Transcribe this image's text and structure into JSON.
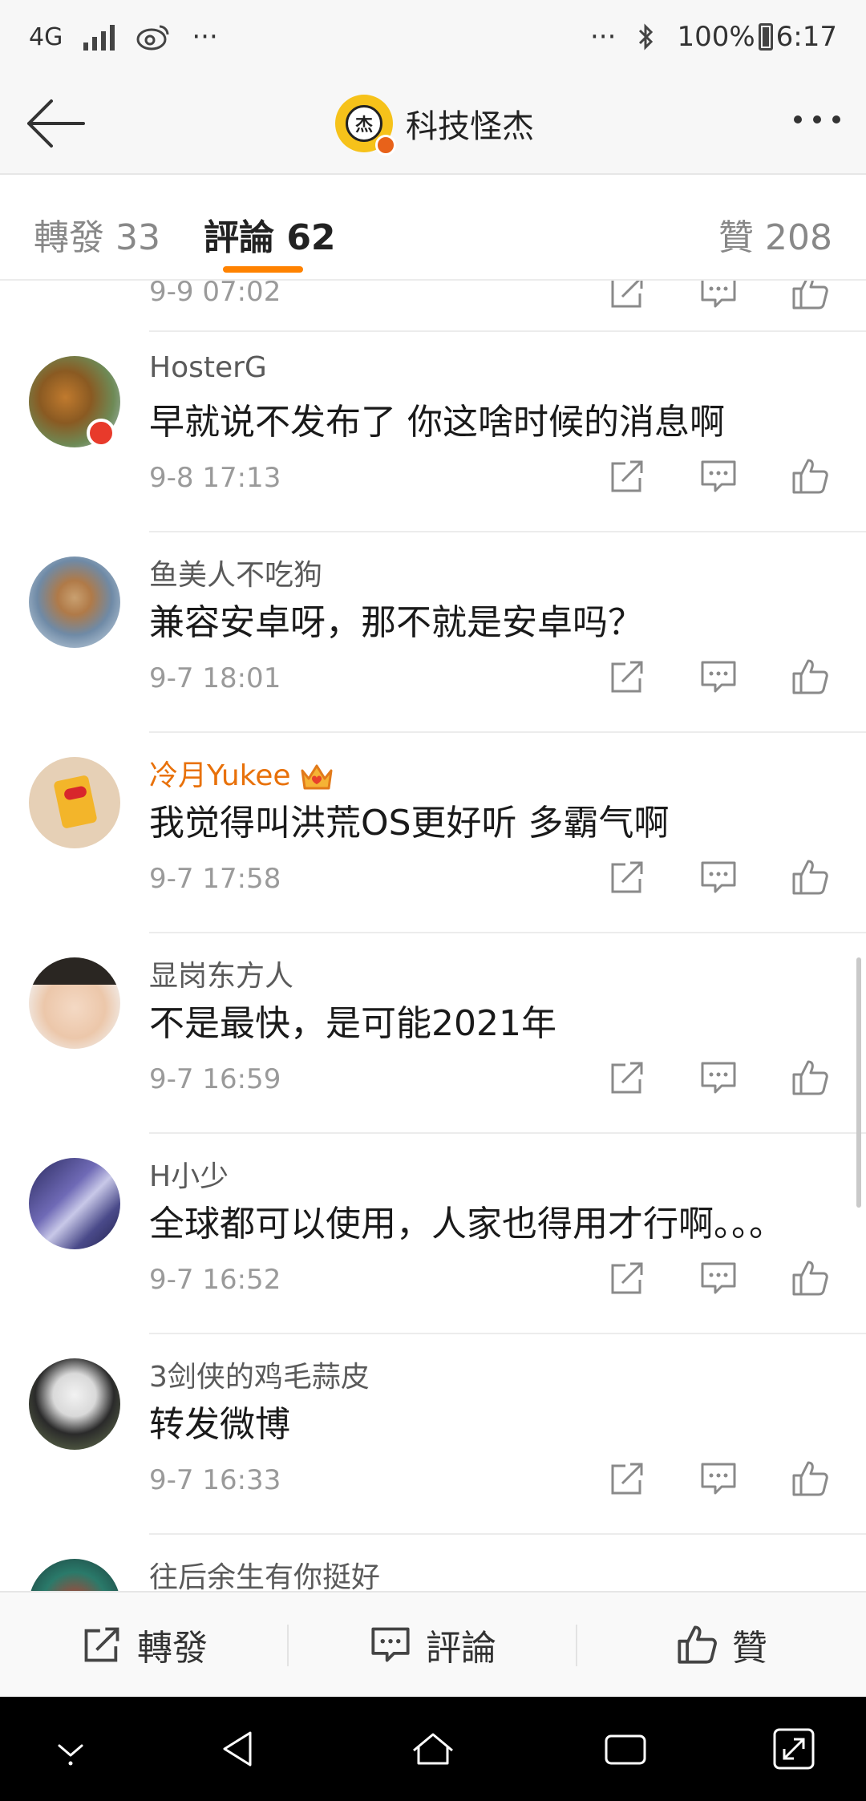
{
  "status_bar": {
    "network": "4G",
    "dots_left": "···",
    "dots_right": "···",
    "battery": "100%",
    "time": "6:17"
  },
  "header": {
    "avatar_glyph": "杰",
    "title": "科技怪杰"
  },
  "tabs": [
    {
      "label": "轉發 33"
    },
    {
      "label": "評論 62"
    },
    {
      "label": "贊 208"
    }
  ],
  "partial_row": {
    "time": "9-9 07:02"
  },
  "comments": [
    {
      "username": "HosterG",
      "text": "早就说不发布了 你这啥时候的消息啊",
      "time": "9-8 17:13"
    },
    {
      "username": "鱼美人不吃狗",
      "text": "兼容安卓呀，那不就是安卓吗？",
      "time": "9-7 18:01"
    },
    {
      "username": "冷月Yukee",
      "text": "我觉得叫洪荒OS更好听 多霸气啊",
      "time": "9-7 17:58"
    },
    {
      "username": "显岗东方人",
      "text": "不是最快，是可能2021年",
      "time": "9-7 16:59"
    },
    {
      "username": "H小少",
      "text": "全球都可以使用，人家也得用才行啊。。。",
      "time": "9-7 16:52"
    },
    {
      "username": "3剑侠的鸡毛蒜皮",
      "text": "转发微博",
      "time": "9-7 16:33"
    },
    {
      "username": "往后余生有你挺好"
    }
  ],
  "bottom_bar": {
    "repost": "轉發",
    "comment": "評論",
    "like": "贊"
  },
  "colors": {
    "accent": "#ff8200",
    "vip_name": "#e8710a"
  }
}
